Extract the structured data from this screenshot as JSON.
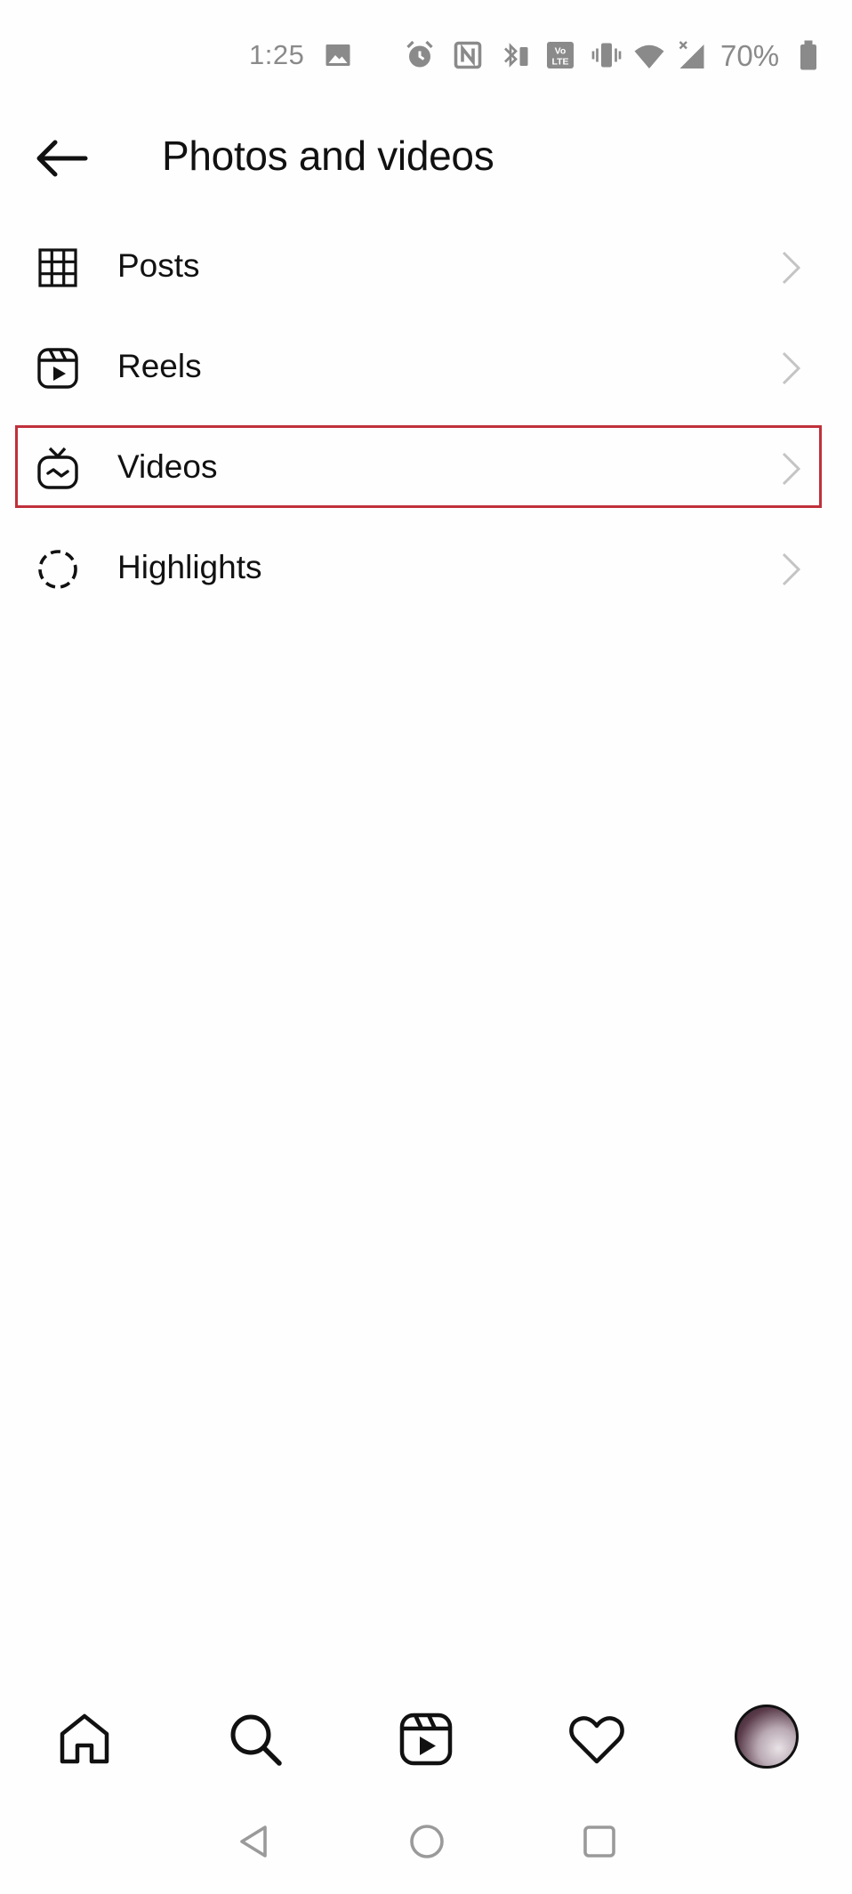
{
  "status_bar": {
    "time": "1:25",
    "battery_percent": "70%",
    "icons": [
      "image-icon",
      "alarm-icon",
      "nfc-icon",
      "bluetooth-battery-icon",
      "volte-icon",
      "vibrate-icon",
      "wifi-icon",
      "signal-icon",
      "battery-icon"
    ]
  },
  "header": {
    "title": "Photos and videos",
    "back_icon": "arrow-left-icon"
  },
  "menu": {
    "items": [
      {
        "label": "Posts",
        "icon": "grid-icon"
      },
      {
        "label": "Reels",
        "icon": "reels-icon"
      },
      {
        "label": "Videos",
        "icon": "igtv-icon",
        "highlighted": true
      },
      {
        "label": "Highlights",
        "icon": "dashed-circle-icon"
      }
    ],
    "highlight_color": "#c0303b"
  },
  "bottom_nav": {
    "items": [
      "home-icon",
      "search-icon",
      "reels-icon",
      "heart-icon",
      "profile-avatar"
    ]
  },
  "system_nav": {
    "items": [
      "back-triangle-icon",
      "home-circle-icon",
      "recents-square-icon"
    ]
  }
}
